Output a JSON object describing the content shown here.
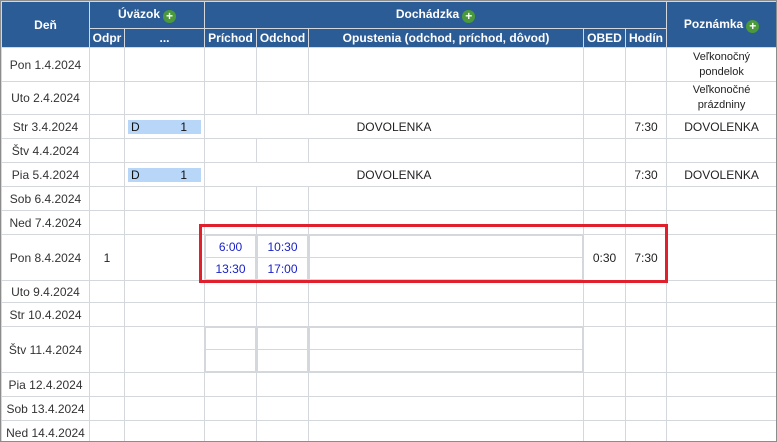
{
  "header": {
    "den": "Deň",
    "uvazok": "Úväzok",
    "dochadzka": "Dochádzka",
    "poznamka": "Poznámka",
    "plus": "+",
    "odpr": "Odpr",
    "ellipsis": "...",
    "prichod": "Príchod",
    "odchod": "Odchod",
    "opustenia": "Opustenia (odchod, príchod, dôvod)",
    "obed": "OBED",
    "hodin": "Hodín"
  },
  "rows": {
    "r1": {
      "day": "Pon 1.4.2024",
      "note1": "Veľkonočný",
      "note2": "pondelok"
    },
    "r2": {
      "day": "Uto 2.4.2024",
      "note1": "Veľkonočné",
      "note2": "prázdniny"
    },
    "r3": {
      "day": "Str 3.4.2024",
      "code": "D",
      "count": "1",
      "leave": "DOVOLENKA",
      "hours": "7:30",
      "note": "DOVOLENKA"
    },
    "r4": {
      "day": "Štv 4.4.2024"
    },
    "r5": {
      "day": "Pia 5.4.2024",
      "code": "D",
      "count": "1",
      "leave": "DOVOLENKA",
      "hours": "7:30",
      "note": "DOVOLENKA"
    },
    "r6": {
      "day": "Sob 6.4.2024"
    },
    "r7": {
      "day": "Ned 7.4.2024"
    },
    "r8": {
      "day": "Pon 8.4.2024",
      "odpr": "1",
      "in1": "6:00",
      "out1": "10:30",
      "in2": "13:30",
      "out2": "17:00",
      "obed": "0:30",
      "hours": "7:30"
    },
    "r9": {
      "day": "Uto 9.4.2024"
    },
    "r10": {
      "day": "Str 10.4.2024"
    },
    "r11": {
      "day": "Štv 11.4.2024"
    },
    "r12": {
      "day": "Pia 12.4.2024"
    },
    "r13": {
      "day": "Sob 13.4.2024"
    },
    "r14": {
      "day": "Ned 14.4.2024"
    }
  }
}
